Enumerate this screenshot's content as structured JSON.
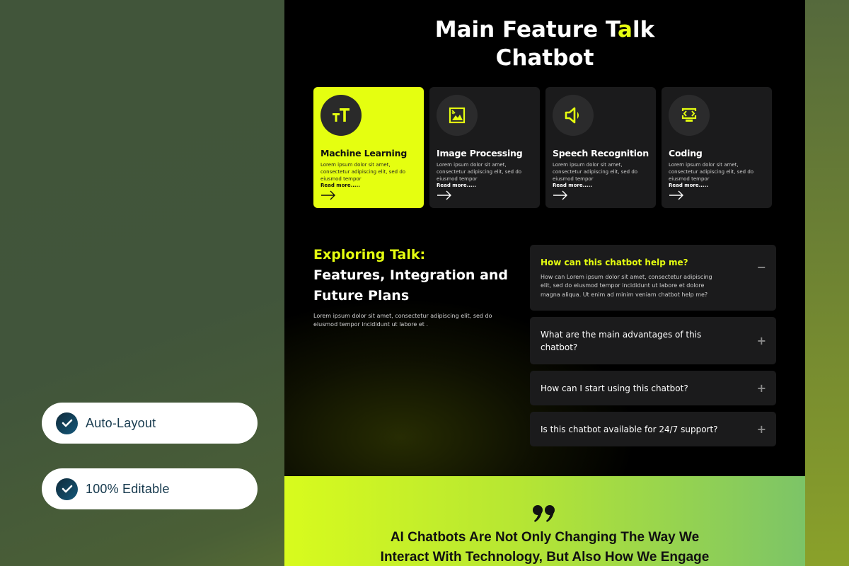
{
  "badges": [
    {
      "label": "Auto-Layout",
      "icon": "check-circle-icon"
    },
    {
      "label": "100% Editable",
      "icon": "check-circle-icon"
    }
  ],
  "header": {
    "title_part1": "Main Feature T",
    "title_accent": "a",
    "title_part2": "lk",
    "title_line2": "Chatbot"
  },
  "features": [
    {
      "title": "Machine Learning",
      "icon": "text-size-icon",
      "desc": "Lorem ipsum dolor sit amet, consectetur adipiscing elit, sed do eiusmod tempor",
      "read_more": "Read more.....",
      "active": true
    },
    {
      "title": "Image Processing",
      "icon": "image-icon",
      "desc": "Lorem ipsum dolor sit amet, consectetur adipiscing elit, sed do eiusmod tempor",
      "read_more": "Read more.....",
      "active": false
    },
    {
      "title": "Speech Recognition",
      "icon": "speaker-icon",
      "desc": "Lorem ipsum dolor sit amet, consectetur adipiscing elit, sed do eiusmod tempor",
      "read_more": "Read more.....",
      "active": false
    },
    {
      "title": "Coding",
      "icon": "code-monitor-icon",
      "desc": "Lorem ipsum dolor sit amet, consectetur adipiscing elit, sed do eiusmod tempor",
      "read_more": "Read more.....",
      "active": false
    }
  ],
  "explore": {
    "heading_accent": "Exploring Talk:",
    "heading_line2": "Features, Integration and",
    "heading_line3": "Future Plans",
    "description": "Lorem ipsum dolor sit amet, consectetur adipiscing elit, sed do eiusmod tempor incididunt ut labore et ."
  },
  "faq": [
    {
      "question": "How can this chatbot help me?",
      "answer": "How can Lorem ipsum dolor sit amet, consectetur adipiscing elit, sed do eiusmod tempor incididunt ut labore et dolore magna aliqua. Ut enim ad minim veniam chatbot help me?",
      "open": true,
      "toggle": "−"
    },
    {
      "question": "What are the main advantages of this chatbot?",
      "open": false,
      "toggle": "+"
    },
    {
      "question": "How can I start using this chatbot?",
      "open": false,
      "toggle": "+"
    },
    {
      "question": "Is this chatbot available for 24/7 support?",
      "open": false,
      "toggle": "+"
    }
  ],
  "quote": {
    "line1": "AI Chatbots Are Not Only Changing The Way We",
    "line2": "Interact With Technology, But Also How We Engage"
  },
  "colors": {
    "accent": "#e5ff10",
    "card_bg": "#1b1b1c",
    "panel_bg": "#000000"
  }
}
